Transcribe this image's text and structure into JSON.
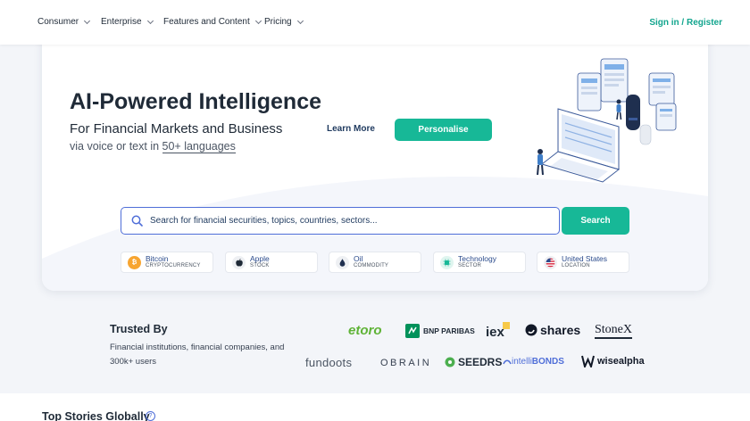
{
  "nav": {
    "items": [
      {
        "label": "Consumer"
      },
      {
        "label": "Enterprise"
      },
      {
        "label": "Features and Content"
      },
      {
        "label": "Pricing"
      }
    ],
    "signin": "Sign in / Register"
  },
  "hero": {
    "title": "AI-Powered Intelligence",
    "subtitle": "For Financial Markets and Business",
    "sub2_prefix": "via voice or text in ",
    "sub2_link": "50+ languages",
    "learn_more": "Learn More",
    "personalise": "Personalise"
  },
  "search": {
    "placeholder": "Search for financial securities, topics, countries, sectors...",
    "button": "Search"
  },
  "chips": [
    {
      "name": "Bitcoin",
      "type": "CRYPTOCURRENCY",
      "icon": "bitcoin-icon"
    },
    {
      "name": "Apple",
      "type": "STOCK",
      "icon": "apple-icon"
    },
    {
      "name": "Oil",
      "type": "COMMODITY",
      "icon": "oil-drop-icon"
    },
    {
      "name": "Technology",
      "type": "SECTOR",
      "icon": "chip-icon"
    },
    {
      "name": "United States",
      "type": "LOCATION",
      "icon": "us-flag-icon"
    }
  ],
  "trusted": {
    "title": "Trusted By",
    "description": "Financial institutions, financial companies, and 300k+ users",
    "logos": {
      "etoro": "etoro",
      "bnp": "BNP PARIBAS",
      "iex": "iex",
      "shares": "shares",
      "stonex": "StoneX",
      "fundoots": "fundoots",
      "obrain": "OBRAIN",
      "seedrs": "SEEDRS",
      "intelli": "intelli",
      "bonds": "BONDS",
      "wisealpha": "wisealpha"
    }
  },
  "stories": {
    "title": "Top Stories Globally"
  },
  "colors": {
    "accent": "#17b897",
    "link": "#12a58e",
    "search_border": "#4f6ed8"
  }
}
